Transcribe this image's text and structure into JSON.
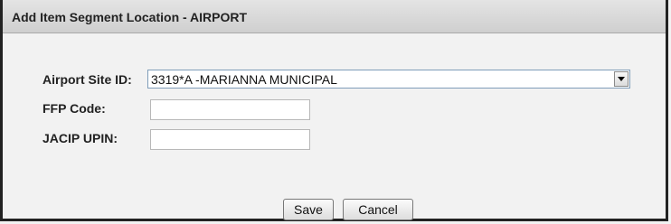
{
  "dialog": {
    "title": "Add Item Segment Location - AIRPORT"
  },
  "form": {
    "airport_site_id": {
      "label": "Airport Site ID:",
      "selected_value": "3319*A -MARIANNA MUNICIPAL"
    },
    "ffp_code": {
      "label": "FFP Code:",
      "value": ""
    },
    "jacip_upin": {
      "label": "JACIP UPIN:",
      "value": ""
    }
  },
  "buttons": {
    "save_label": "Save",
    "cancel_label": "Cancel"
  },
  "icons": {
    "dropdown": "chevron-down-icon"
  }
}
